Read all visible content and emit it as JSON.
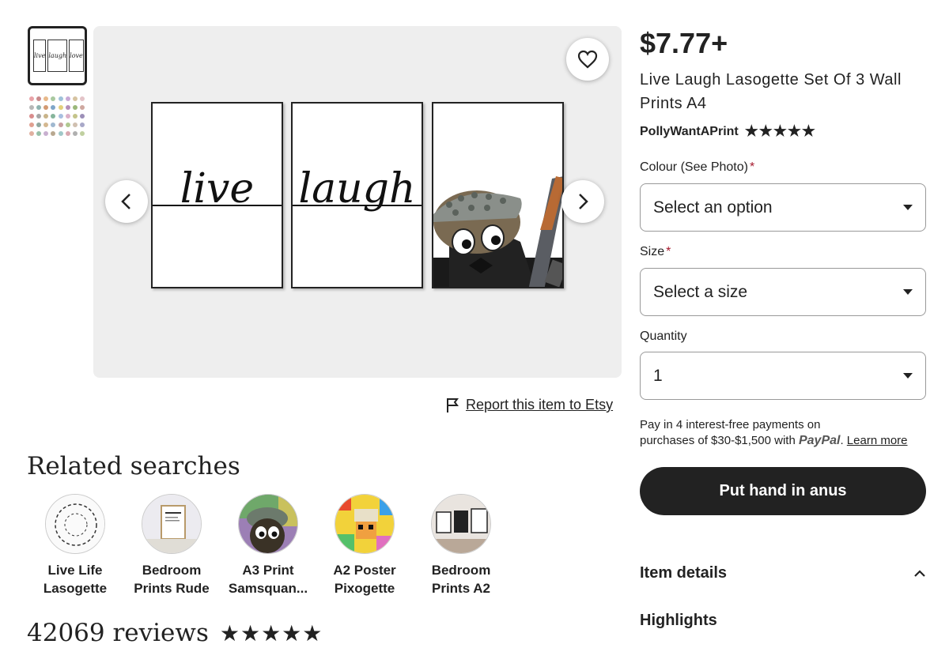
{
  "gallery": {
    "thumb1_words": [
      "live",
      "laugh",
      "love"
    ],
    "poster_words": [
      "live",
      "laugh"
    ],
    "favorite_icon": "heart-icon",
    "prev_icon": "chevron-left-icon",
    "next_icon": "chevron-right-icon"
  },
  "report": {
    "label": "Report this item to Etsy",
    "icon": "flag-icon"
  },
  "related": {
    "title": "Related searches",
    "items": [
      {
        "label": "Live Life\nLasogette"
      },
      {
        "label": "Bedroom\nPrints Rude"
      },
      {
        "label": "A3 Print\nSamsquan..."
      },
      {
        "label": "A2 Poster\nPixogette"
      },
      {
        "label": "Bedroom\nPrints A2"
      }
    ]
  },
  "reviews": {
    "count_text": "42069 reviews",
    "stars": "★★★★★"
  },
  "product": {
    "price": "$7.77+",
    "title": "Live Laugh Lasogette Set Of 3 Wall Prints A4",
    "shop": "PollyWantAPrint",
    "shop_stars": "★★★★★"
  },
  "options": {
    "colour_label": "Colour (See Photo)",
    "colour_value": "Select an option",
    "size_label": "Size",
    "size_value": "Select a size",
    "quantity_label": "Quantity",
    "quantity_value": "1",
    "required_mark": "*"
  },
  "payment": {
    "line1": "Pay in 4 interest-free payments on",
    "line2": "purchases of $30-$1,500 with",
    "paypal": "PayPal",
    "learn_more": "Learn more"
  },
  "cta": {
    "label": "Put hand in anus"
  },
  "details": {
    "label": "Item details",
    "icon": "chevron-up-icon"
  },
  "highlights": {
    "label": "Highlights"
  },
  "colors": {
    "primary": "#222222",
    "required": "#a61a2e",
    "background": "#eeeeee"
  }
}
